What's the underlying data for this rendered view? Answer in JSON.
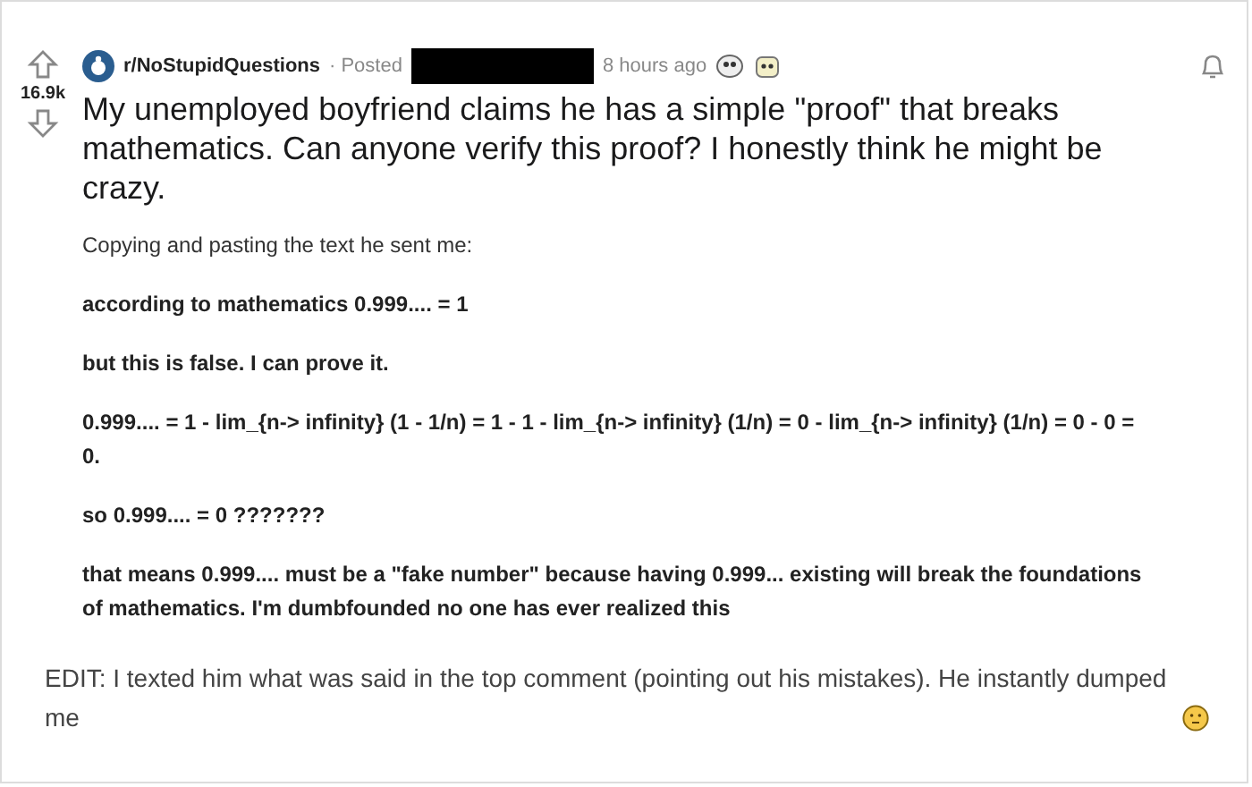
{
  "post": {
    "score": "16.9k",
    "subreddit": "r/NoStupidQuestions",
    "posted_label": "· Posted",
    "time": "8 hours ago",
    "title": "My unemployed boyfriend claims he has a simple \"proof\" that breaks mathematics. Can anyone verify this proof? I honestly think he might be crazy.",
    "body": [
      {
        "text": "Copying and pasting the text he sent me:",
        "bold": false
      },
      {
        "text": "according to mathematics 0.999.... = 1",
        "bold": true
      },
      {
        "text": "but this is false. I can prove it.",
        "bold": true
      },
      {
        "text": "0.999.... = 1 - lim_{n-> infinity} (1 - 1/n) = 1 - 1 - lim_{n-> infinity} (1/n) = 0 - lim_{n-> infinity} (1/n) = 0 - 0 = 0.",
        "bold": true
      },
      {
        "text": "so 0.999.... = 0 ???????",
        "bold": true
      },
      {
        "text": "that means 0.999.... must be a \"fake number\" because having 0.999... existing will break the foundations of mathematics. I'm dumbfounded no one has ever realized this",
        "bold": true
      }
    ],
    "edit": "EDIT: I texted him what was said in the top comment (pointing out his mistakes). He instantly dumped me"
  }
}
